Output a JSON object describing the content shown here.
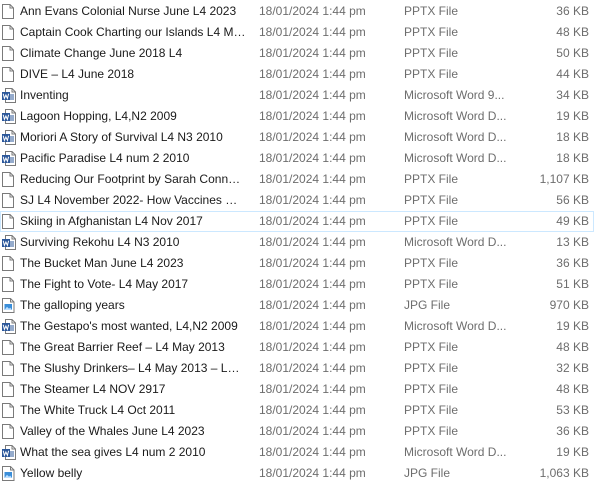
{
  "colors": {
    "hover_border": "#cce8ff",
    "secondary_text": "#6d6d6d",
    "primary_text": "#1a1a1a",
    "word_blue": "#2b579a"
  },
  "files": [
    {
      "name": "Ann Evans Colonial Nurse June L4 2023",
      "date": "18/01/2024 1:44 pm",
      "type": "PPTX File",
      "size": "36 KB",
      "icon": "document-icon"
    },
    {
      "name": "Captain Cook Charting our Islands L4 Ma...",
      "date": "18/01/2024 1:44 pm",
      "type": "PPTX File",
      "size": "48 KB",
      "icon": "document-icon"
    },
    {
      "name": "Climate Change June 2018 L4",
      "date": "18/01/2024 1:44 pm",
      "type": "PPTX File",
      "size": "50 KB",
      "icon": "document-icon"
    },
    {
      "name": "DIVE – L4 June 2018",
      "date": "18/01/2024 1:44 pm",
      "type": "PPTX File",
      "size": "44 KB",
      "icon": "document-icon"
    },
    {
      "name": "Inventing",
      "date": "18/01/2024 1:44 pm",
      "type": "Microsoft Word 9...",
      "size": "34 KB",
      "icon": "word-document-icon"
    },
    {
      "name": "Lagoon Hopping, L4,N2 2009",
      "date": "18/01/2024 1:44 pm",
      "type": "Microsoft Word D...",
      "size": "19 KB",
      "icon": "word-document-icon"
    },
    {
      "name": "Moriori A Story of Survival L4 N3 2010",
      "date": "18/01/2024 1:44 pm",
      "type": "Microsoft Word D...",
      "size": "18 KB",
      "icon": "word-document-icon"
    },
    {
      "name": "Pacific Paradise L4 num 2 2010",
      "date": "18/01/2024 1:44 pm",
      "type": "Microsoft Word D...",
      "size": "18 KB",
      "icon": "word-document-icon"
    },
    {
      "name": "Reducing Our Footprint by Sarah Connor...",
      "date": "18/01/2024 1:44 pm",
      "type": "PPTX File",
      "size": "1,107 KB",
      "icon": "document-icon"
    },
    {
      "name": "SJ L4 November 2022- How Vaccines Work",
      "date": "18/01/2024 1:44 pm",
      "type": "PPTX File",
      "size": "56 KB",
      "icon": "document-icon"
    },
    {
      "name": "Skiing in Afghanistan L4 Nov 2017",
      "date": "18/01/2024 1:44 pm",
      "type": "PPTX File",
      "size": "49 KB",
      "icon": "document-icon",
      "hovered": true
    },
    {
      "name": "Surviving Rekohu L4 N3 2010",
      "date": "18/01/2024 1:44 pm",
      "type": "Microsoft Word D...",
      "size": "13 KB",
      "icon": "word-document-icon"
    },
    {
      "name": "The Bucket Man June L4 2023",
      "date": "18/01/2024 1:44 pm",
      "type": "PPTX File",
      "size": "36 KB",
      "icon": "document-icon"
    },
    {
      "name": "The Fight to Vote- L4 May 2017",
      "date": "18/01/2024 1:44 pm",
      "type": "PPTX File",
      "size": "51 KB",
      "icon": "document-icon"
    },
    {
      "name": "The galloping years",
      "date": "18/01/2024 1:44 pm",
      "type": "JPG File",
      "size": "970 KB",
      "icon": "image-file-icon"
    },
    {
      "name": "The Gestapo's most wanted, L4,N2 2009",
      "date": "18/01/2024 1:44 pm",
      "type": "Microsoft Word D...",
      "size": "19 KB",
      "icon": "word-document-icon"
    },
    {
      "name": "The Great Barrier Reef – L4 May 2013",
      "date": "18/01/2024 1:44 pm",
      "type": "PPTX File",
      "size": "48 KB",
      "icon": "document-icon"
    },
    {
      "name": "The Slushy Drinkers– L4 May 2013 – L4 M...",
      "date": "18/01/2024 1:44 pm",
      "type": "PPTX File",
      "size": "32 KB",
      "icon": "document-icon"
    },
    {
      "name": "The Steamer L4 NOV 2917",
      "date": "18/01/2024 1:44 pm",
      "type": "PPTX File",
      "size": "48 KB",
      "icon": "document-icon"
    },
    {
      "name": "The White Truck L4 Oct 2011",
      "date": "18/01/2024 1:44 pm",
      "type": "PPTX File",
      "size": "53 KB",
      "icon": "document-icon"
    },
    {
      "name": "Valley of the Whales June L4 2023",
      "date": "18/01/2024 1:44 pm",
      "type": "PPTX File",
      "size": "36 KB",
      "icon": "document-icon"
    },
    {
      "name": "What the sea gives L4 num 2 2010",
      "date": "18/01/2024 1:44 pm",
      "type": "Microsoft Word D...",
      "size": "19 KB",
      "icon": "word-document-icon"
    },
    {
      "name": "Yellow belly",
      "date": "18/01/2024 1:44 pm",
      "type": "JPG File",
      "size": "1,063 KB",
      "icon": "image-file-icon"
    }
  ]
}
